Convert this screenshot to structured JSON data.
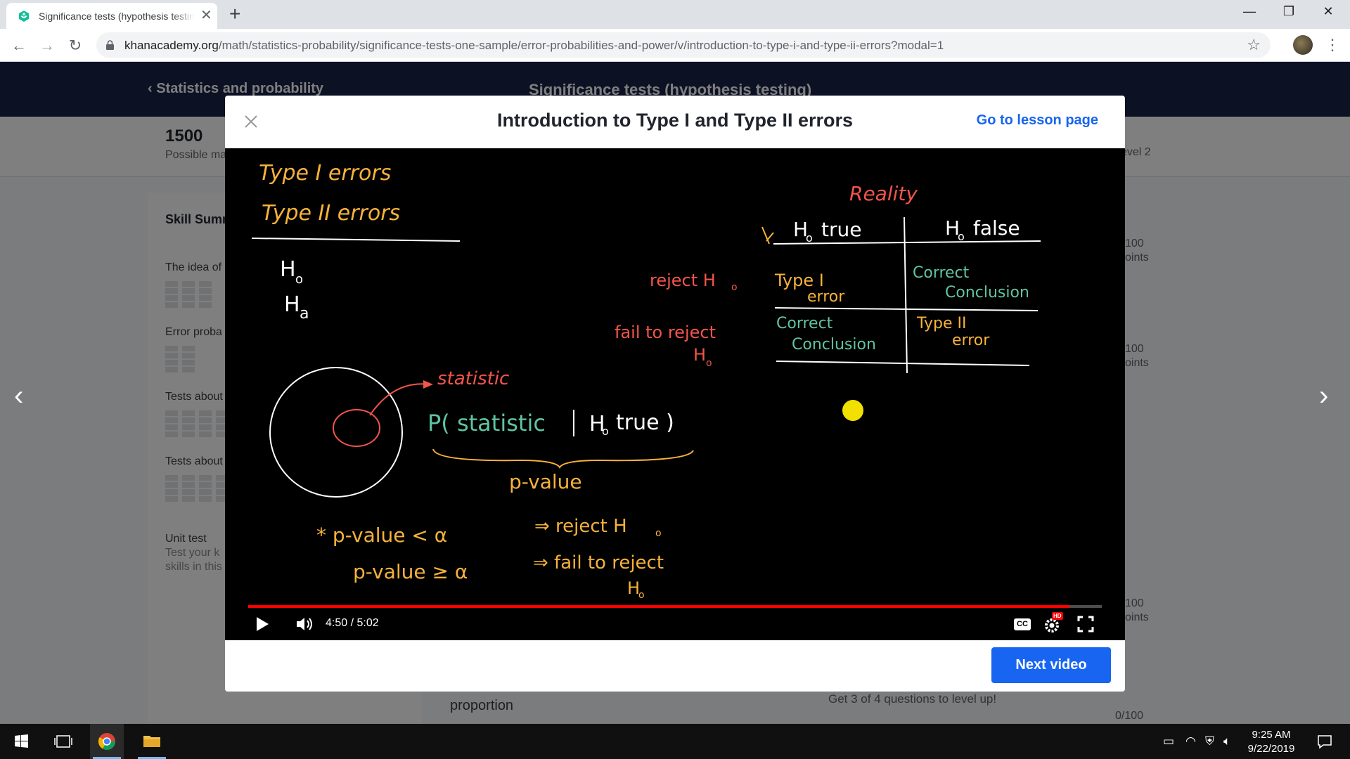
{
  "browser": {
    "tab_title": "Significance tests (hypothesis testing)",
    "url_host": "khanacademy.org",
    "url_path": "/math/statistics-probability/significance-tests-one-sample/error-probabilities-and-power/v/introduction-to-type-i-and-type-ii-errors?modal=1"
  },
  "page": {
    "breadcrumb": "Statistics and probability",
    "unit_title": "Significance tests (hypothesis testing)",
    "points": "1500",
    "points_sub": "Possible ma",
    "level_label": "evel 2",
    "skill_summary": "Skill Sumr",
    "skills": [
      "The idea of",
      "Error proba",
      "Tests about",
      "Tests about"
    ],
    "unit_test": "Unit test",
    "unit_test_desc_1": "Test your k",
    "unit_test_desc_2": "skills in this",
    "scores": [
      "100",
      "oints",
      "100",
      "oints",
      "100",
      "oints"
    ],
    "bottom_item": "proportion",
    "bottom_prompt": "Get 3 of 4 questions to level up!",
    "bottom_score": "0/100"
  },
  "modal": {
    "title": "Introduction to Type I and Type II errors",
    "lesson_link": "Go to lesson page",
    "next_button": "Next video"
  },
  "player": {
    "time": "4:50 / 5:02",
    "progress": 0.962,
    "cc_label": "CC",
    "hd_badge": "HD"
  },
  "board": {
    "heading_1": "Type I errors",
    "heading_2": "Type II errors",
    "h0": "H",
    "h0_sub": "o",
    "ha": "H",
    "ha_sub": "a",
    "reality": "Reality",
    "col_true": "H",
    "col_true_suffix": "true",
    "col_false": "H",
    "col_false_suffix": "false",
    "row_reject": "reject H",
    "row_fail_1": "fail to reject",
    "row_fail_2": "H",
    "cell_11_a": "Type I",
    "cell_11_b": "error",
    "cell_12_a": "Correct",
    "cell_12_b": "Conclusion",
    "cell_21_a": "Correct",
    "cell_21_b": "Conclusion",
    "cell_22_a": "Type II",
    "cell_22_b": "error",
    "statistic": "statistic",
    "prob_left": "P( statistic",
    "prob_mid": "H",
    "prob_right": "true )",
    "pvalue": "p-value",
    "rule1_left": "* p-value < α",
    "rule1_right": "⇒ reject H",
    "rule2_left": "p-value ≥ α",
    "rule2_right": "⇒ fail to reject",
    "rule2_tail": "H",
    "sub_o": "o"
  },
  "taskbar": {
    "time": "9:25 AM",
    "date": "9/22/2019"
  },
  "colors": {
    "ka_navy": "#1a2349",
    "ka_blue": "#1865f2",
    "chalk_yellow": "#f7b23b",
    "chalk_red": "#f2554a",
    "chalk_green": "#5fc4a3",
    "chalk_white": "#ffffff",
    "pointer": "#f2e100"
  }
}
